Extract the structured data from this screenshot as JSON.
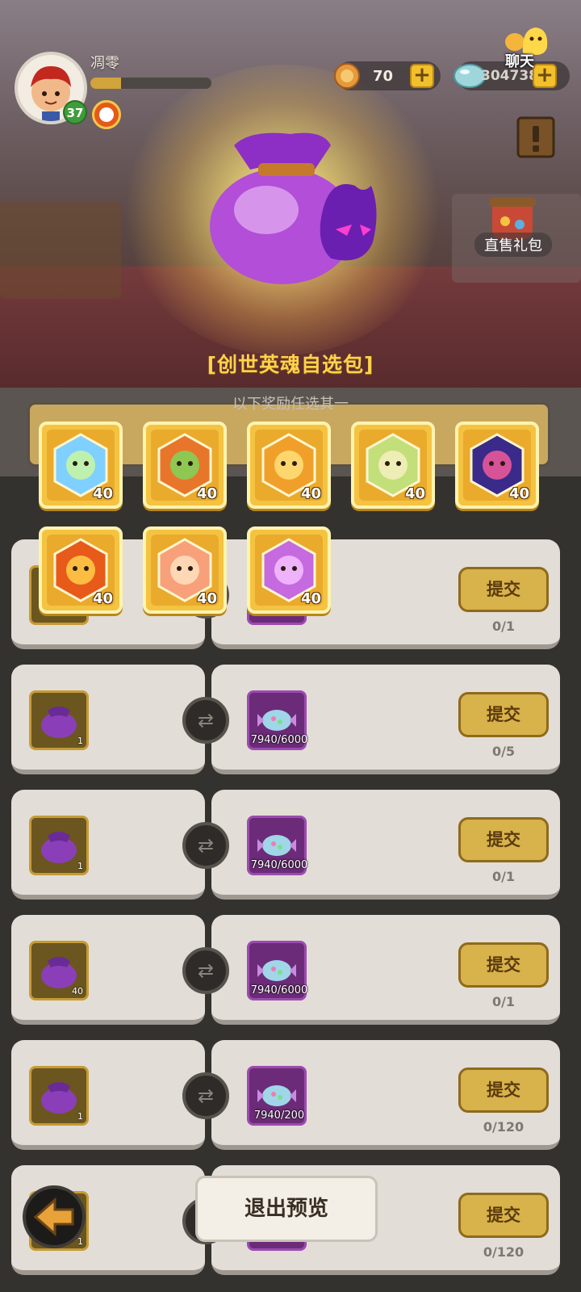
{
  "user": {
    "name": "凋零",
    "level": "37",
    "xp_progress": 0.25
  },
  "currency": {
    "gold": {
      "value": "70",
      "plus": "+"
    },
    "gems": {
      "value": "304738",
      "plus": "+"
    }
  },
  "side": {
    "chat_label": "聊天",
    "gift_label": "直售礼包"
  },
  "pack": {
    "title": "[创世英魂自选包]",
    "subtitle": "以下奖励任选其一",
    "rewards": [
      {
        "icon": "rainbow-crystal",
        "count": "40"
      },
      {
        "icon": "monkey-hero",
        "count": "40"
      },
      {
        "icon": "tiger-hero",
        "count": "40"
      },
      {
        "icon": "sloth-hero",
        "count": "40"
      },
      {
        "icon": "dark-spirit-hero",
        "count": "40"
      },
      {
        "icon": "flame-warrior-hero",
        "count": "40"
      },
      {
        "icon": "fire-spirit-hero",
        "count": "40"
      },
      {
        "icon": "purple-ghost-hero",
        "count": "40"
      }
    ]
  },
  "exchange": {
    "submit_label": "提交",
    "rows": [
      {
        "left_icon": "hidden-item",
        "left_count": "",
        "right_icon": "hidden-item",
        "right_count": "",
        "progress": "0/1"
      },
      {
        "left_icon": "purple-bag",
        "left_count": "1",
        "right_icon": "candy",
        "right_count": "7940/6000",
        "progress": "0/5"
      },
      {
        "left_icon": "purple-bag",
        "left_count": "1",
        "right_icon": "candy",
        "right_count": "7940/6000",
        "progress": "0/1"
      },
      {
        "left_icon": "penguin-hero",
        "left_count": "40",
        "right_icon": "candy",
        "right_count": "7940/6000",
        "progress": "0/1"
      },
      {
        "left_icon": "food-box",
        "left_count": "1",
        "right_icon": "candy",
        "right_count": "7940/200",
        "progress": "0/120"
      },
      {
        "left_icon": "food-box",
        "left_count": "1",
        "right_icon": "candy",
        "right_count": "",
        "progress": "0/120"
      }
    ]
  },
  "footer": {
    "exit_label": "退出预览"
  },
  "colors": {
    "gold": "#f5c342",
    "title": "#ffd24a",
    "submit": "#d8b24a"
  }
}
